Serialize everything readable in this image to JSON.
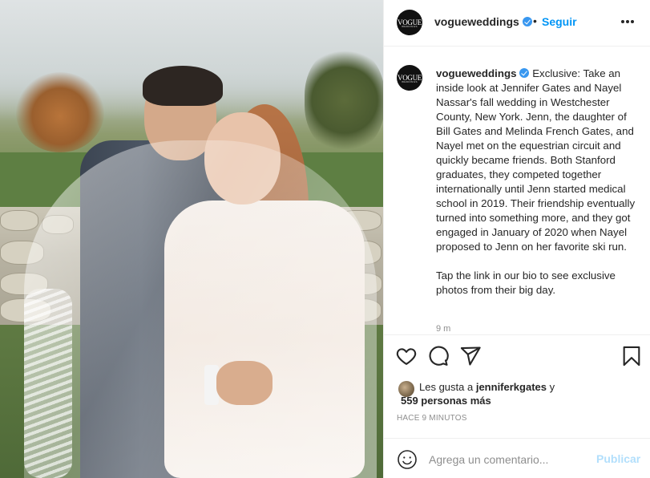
{
  "account": {
    "username": "vogueweddings",
    "avatar_text": "VOGUE",
    "avatar_subtext": "WEDDINGS",
    "verified": true
  },
  "header": {
    "dot": "•",
    "follow_label": "Seguir"
  },
  "caption": {
    "username": "vogueweddings",
    "text": "Exclusive: Take an inside look at Jennifer Gates and Nayel Nassar's fall wedding in Westchester County, New York. Jenn, the daughter of Bill Gates and Melinda French Gates, and Nayel met on the equestrian circuit and quickly became friends. Both Stanford graduates, they competed together internationally until Jenn started medical school in 2019. Their friendship eventually turned into something more, and they got engaged in January of 2020 when Nayel proposed to Jenn on her favorite ski run.\n\nTap the link in our bio to see exclusive photos from their big day.",
    "age": "9 m"
  },
  "likes": {
    "prefix": "Les gusta a",
    "liked_by": "jenniferkgates",
    "suffix": "y",
    "others": "559 personas más"
  },
  "timestamp": "HACE 9 MINUTOS",
  "comment_box": {
    "placeholder": "Agrega un comentario...",
    "post_label": "Publicar"
  },
  "icons": {
    "like": "heart-icon",
    "comment": "comment-icon",
    "share": "paper-plane-icon",
    "save": "bookmark-icon",
    "emoji": "smiley-icon",
    "more": "more-options-icon"
  },
  "colors": {
    "accent": "#0095f6",
    "verified": "#3897f0",
    "muted": "#8e8e8e",
    "post_disabled": "#b2dffc"
  }
}
